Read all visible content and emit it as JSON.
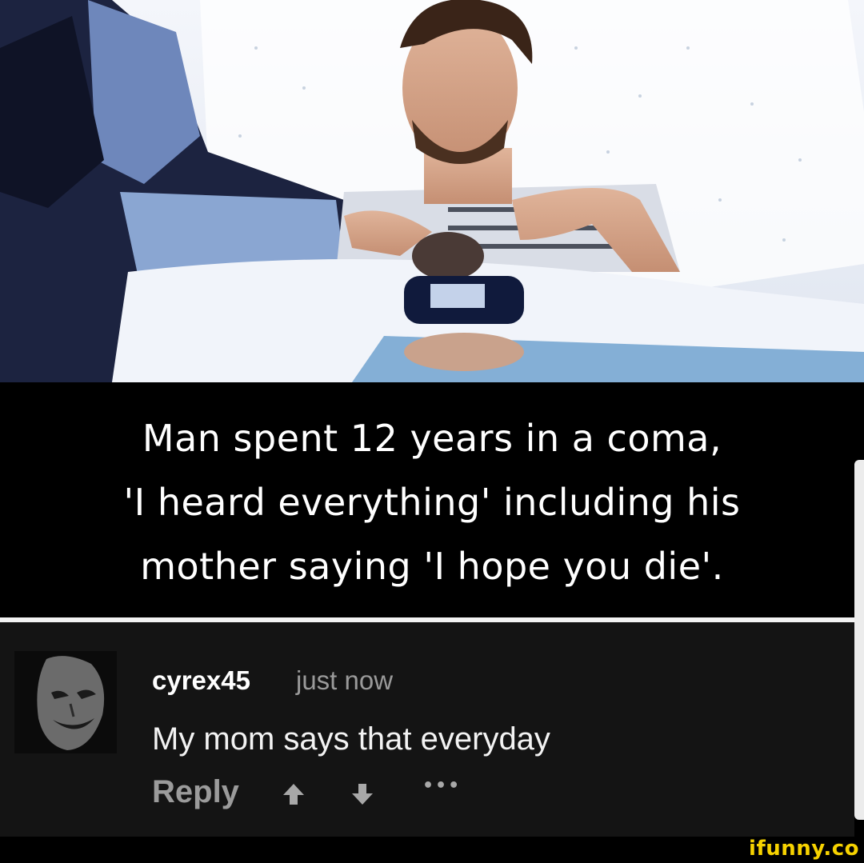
{
  "post": {
    "headline": "Man spent 12 years in a coma,\n'I heard everything' including his\nmother saying 'I hope you die'."
  },
  "comment": {
    "username": "cyrex45",
    "timestamp": "just now",
    "text": "My mom says that everyday",
    "reply_label": "Reply",
    "more_label": "•••"
  },
  "watermark": "ifunny.co"
}
